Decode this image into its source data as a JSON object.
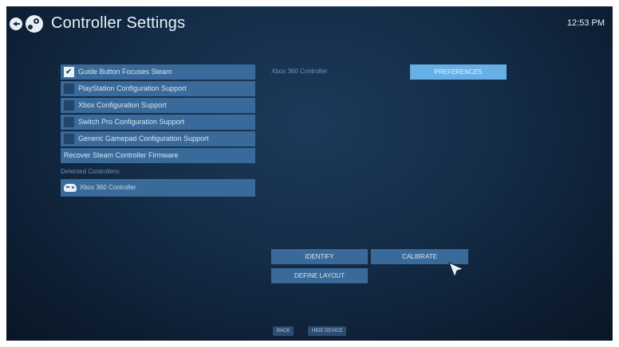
{
  "header": {
    "title": "Controller Settings",
    "clock": "12:53 PM"
  },
  "left_panel": {
    "options": [
      {
        "label": "Guide Button Focuses Steam",
        "checked": true
      },
      {
        "label": "PlayStation Configuration Support",
        "checked": false
      },
      {
        "label": "Xbox Configuration Support",
        "checked": false
      },
      {
        "label": "Switch Pro Configuration Support",
        "checked": false
      },
      {
        "label": "Generic Gamepad Configuration Support",
        "checked": false
      }
    ],
    "recover_label": "Recover Steam Controller Firmware",
    "detected_label": "Detected Controllers:",
    "controllers": [
      {
        "name": "Xbox 360 Controller",
        "icon": "gamepad-icon"
      }
    ]
  },
  "right_panel": {
    "controller_name": "Xbox 360 Controller",
    "preferences_label": "PREFERENCES",
    "identify_label": "IDENTIFY",
    "calibrate_label": "CALIBRATE",
    "define_layout_label": "DEFINE LAYOUT"
  },
  "footer": {
    "back_label": "BACK",
    "hide_device_label": "HIDE DEVICE"
  },
  "colors": {
    "button": "#3a6a99",
    "accent": "#66b0e6",
    "background": "#142c47"
  }
}
